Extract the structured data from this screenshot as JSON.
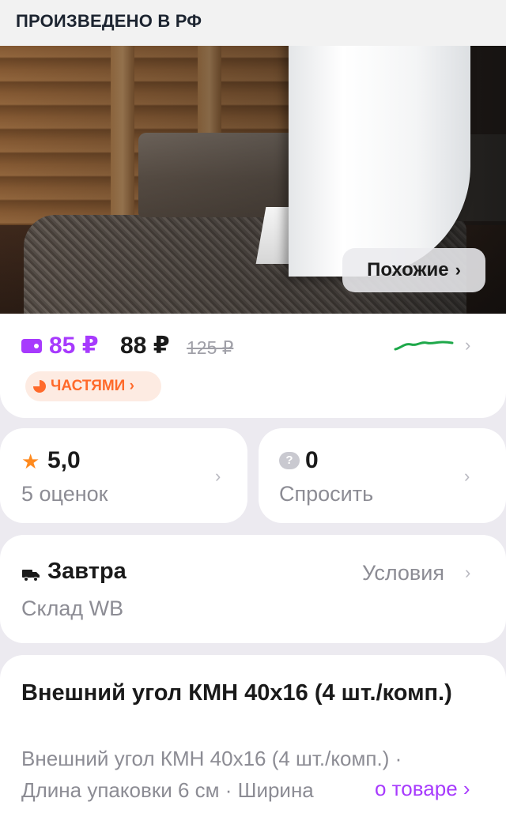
{
  "hero": {
    "banner_text": "ПРОИЗВЕДЕНО В РФ",
    "similar_label": "Похожие",
    "similar_chevron": "›"
  },
  "price": {
    "wallet_price": "85 ₽",
    "main_price": "88 ₽",
    "old_price": "125 ₽",
    "chevron": "›",
    "installment_label": "ЧАСТЯМИ ›",
    "wallet_color": "#a73afd",
    "installment_color": "#ff6a2b",
    "spark_color": "#1ea84a"
  },
  "rating": {
    "icon": "star-icon",
    "value": "5,0",
    "count": "5 оценок",
    "chevron": "›"
  },
  "questions": {
    "icon_glyph": "?",
    "value": "0",
    "label": "Спросить",
    "chevron": "›"
  },
  "delivery": {
    "icon": "truck-icon",
    "title": "Завтра",
    "warehouse": "Склад WB",
    "conditions": "Условия",
    "chevron": "›"
  },
  "description": {
    "title": "Внешний угол КМН 40x16 (4 шт./комп.)",
    "body_line1": "Внешний угол КМН 40x16 (4 шт./комп.) ·",
    "body_line2": "Длина упаковки 6 см · Ширина",
    "more_link": "о товаре ›"
  }
}
